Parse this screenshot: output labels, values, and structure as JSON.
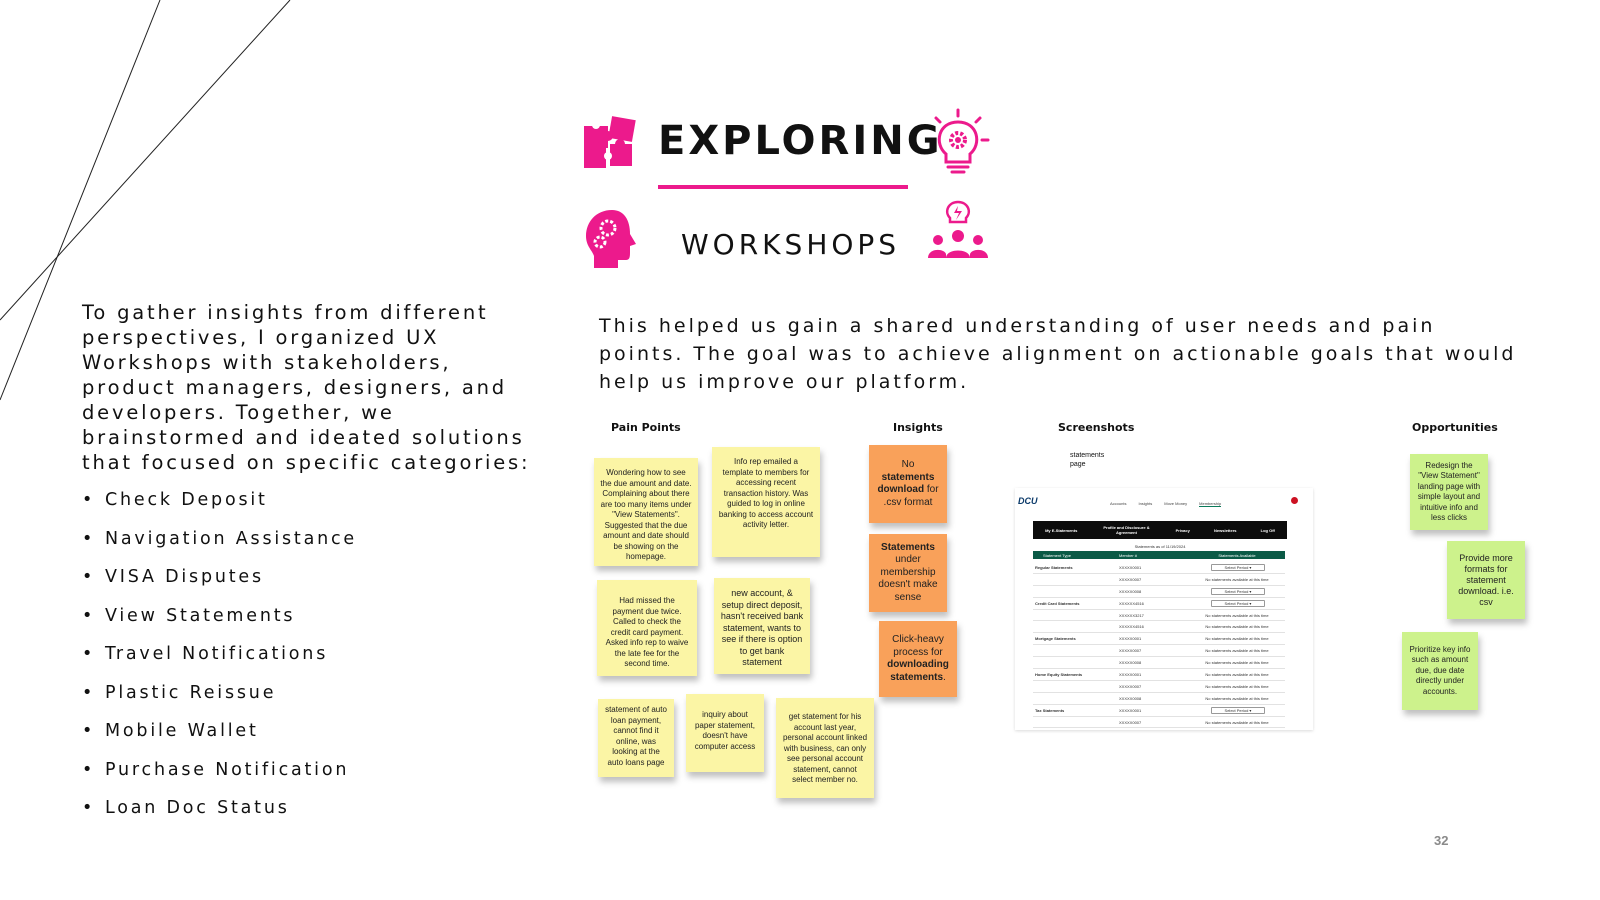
{
  "header": {
    "title": "EXPLORING",
    "subtitle": "WORKSHOPS"
  },
  "colors": {
    "accent": "#ec1a8c",
    "yellow_note": "#fbf5a5",
    "orange_note": "#f9a15a",
    "green_note": "#cdf28c"
  },
  "icons": [
    "puzzle-icon",
    "lightbulb-gear-icon",
    "head-gears-icon",
    "team-idea-icon"
  ],
  "intro": "To gather insights from different perspectives, I organized UX Workshops with stakeholders, product managers, designers, and developers. Together, we brainstormed and ideated solutions that focused on specific categories:",
  "categories": [
    "Check Deposit",
    "Navigation Assistance",
    "VISA Disputes",
    "View Statements",
    "Travel Notifications",
    "Plastic Reissue",
    "Mobile Wallet",
    "Purchase Notification",
    "Loan Doc Status"
  ],
  "summary": "This helped us gain a shared understanding of user needs and pain points. The goal was to achieve alignment on actionable goals that would help us improve our platform.",
  "board": {
    "columns": {
      "pain_points": "Pain Points",
      "insights": "Insights",
      "screenshots": "Screenshots",
      "opportunities": "Opportunities"
    },
    "pain_points": [
      "Wondering how to see the due amount and date. Complaining about there are too many items under \"View Statements\". Suggested that the due amount and date should be showing on the homepage.",
      "Info rep emailed a template to members for accessing recent transaction history. Was guided to log in online banking to access account activity letter.",
      "Had missed the payment due twice. Called to check the credit card payment. Asked info rep to waive the late fee for the second time.",
      "new account, & setup direct deposit, hasn't received bank statement, wants to see if there is option to get bank statement",
      "statement of auto loan payment, cannot find it online, was looking at the auto loans page",
      "inquiry about paper statement, doesn't have computer access",
      "get statement for his account last year, personal account linked with business, can only see personal account statement, cannot select member no."
    ],
    "insights": {
      "note1": {
        "pre": "No ",
        "bold": "statements download",
        "post": " for .csv format"
      },
      "note2": {
        "bold": "Statements",
        "post": " under membership doesn't make sense"
      },
      "note3": {
        "pre": "Click-heavy process for ",
        "bold": "downloading statements",
        "post": "."
      }
    },
    "screenshot": {
      "caption": "statements page",
      "logo": "DCU",
      "nav": [
        "Accounts",
        "Insights",
        "Move Money",
        "Membership"
      ],
      "menu": [
        "My E-Statements",
        "Profile and Disclosure & Agreement",
        "Privacy",
        "Newsletters",
        "Log Off"
      ],
      "table_header": [
        "Statement Type",
        "Member #",
        "Statements Available"
      ],
      "subheader": "Statements as of 11/19/2024",
      "rows": [
        {
          "type": "Regular Statements",
          "member": "XXXXX0001",
          "status": "Select Period ▾"
        },
        {
          "type": "",
          "member": "XXXXX0007",
          "status": "No statements available at this time"
        },
        {
          "type": "",
          "member": "XXXXX0008",
          "status": "Select Period ▾"
        },
        {
          "type": "Credit Card Statements",
          "member": "XXXXXX4516",
          "status": "Select Period ▾"
        },
        {
          "type": "",
          "member": "XXXXXX3217",
          "status": "No statements available at this time"
        },
        {
          "type": "",
          "member": "XXXXXX4516",
          "status": "No statements available at this time"
        },
        {
          "type": "Mortgage Statements",
          "member": "XXXXX0001",
          "status": "No statements available at this time"
        },
        {
          "type": "",
          "member": "XXXXX0007",
          "status": "No statements available at this time"
        },
        {
          "type": "",
          "member": "XXXXX0008",
          "status": "No statements available at this time"
        },
        {
          "type": "Home Equity Statements",
          "member": "XXXXX0001",
          "status": "No statements available at this time"
        },
        {
          "type": "",
          "member": "XXXXX0007",
          "status": "No statements available at this time"
        },
        {
          "type": "",
          "member": "XXXXX0008",
          "status": "No statements available at this time"
        },
        {
          "type": "Tax Statements",
          "member": "XXXXX0001",
          "status": "Select Period ▾"
        },
        {
          "type": "",
          "member": "XXXXX0007",
          "status": "No statements available at this time"
        }
      ]
    },
    "opportunities": [
      "Redesign the \"View Statement\" landing page with simple layout and intuitive info and less clicks",
      "Provide more formats for statement download. i.e. csv",
      "Prioritize key info such as amount due, due date directly under accounts."
    ]
  },
  "page_number": "32"
}
